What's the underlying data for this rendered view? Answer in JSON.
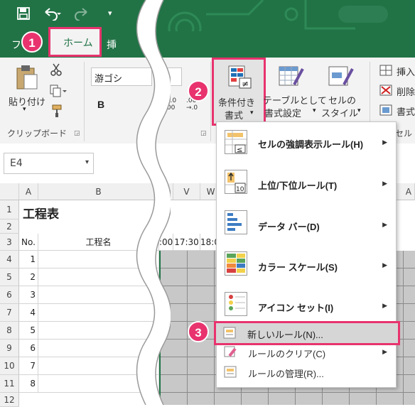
{
  "tabs": {
    "file_partial": "フ",
    "home": "ホーム",
    "insert_partial": "挿"
  },
  "badges": {
    "one": "1",
    "two": "2",
    "three": "3"
  },
  "clipboard": {
    "paste_label": "貼り付け",
    "group_label": "クリップボード"
  },
  "font": {
    "name_value": "游ゴシ",
    "bold": "B"
  },
  "number": {
    "dec_inc": ".0\n.00",
    "dec_dec": ".00\n→.0"
  },
  "styles": {
    "cond_format_line1": "条件付き",
    "cond_format_line2": "書式",
    "table_format_line1": "テーブルとして",
    "table_format_line2": "書式設定",
    "cell_style_line1": "セルの",
    "cell_style_line2": "スタイル"
  },
  "cells_group": {
    "insert": "挿入",
    "delete": "削除",
    "format": "書式",
    "group_partial": "セル"
  },
  "namebox": {
    "value": "E4"
  },
  "columns": {
    "a": "A",
    "b": "B",
    "v": "V",
    "w": "W",
    "far": "A"
  },
  "rows": [
    "1",
    "2",
    "3",
    "4",
    "5",
    "6",
    "7",
    "8",
    "9",
    "10",
    "11",
    "12"
  ],
  "sheet": {
    "title": "工程表",
    "header_no": "No.",
    "header_name": "工程名",
    "time_00": ":00",
    "time_1730": "17:30",
    "time_18": "18:0",
    "numbers": [
      "1",
      "2",
      "3",
      "4",
      "5",
      "6",
      "7",
      "8"
    ]
  },
  "menu": {
    "items": [
      {
        "label": "セルの強調表示ルール(H)",
        "icon": "highlight-rules-icon"
      },
      {
        "label": "上位/下位ルール(T)",
        "icon": "top-bottom-icon"
      },
      {
        "label": "データ バー(D)",
        "icon": "data-bar-icon"
      },
      {
        "label": "カラー スケール(S)",
        "icon": "color-scale-icon"
      },
      {
        "label": "アイコン セット(I)",
        "icon": "icon-set-icon"
      }
    ],
    "new_rule": "新しいルール(N)...",
    "clear_rules": "ルールのクリア(C)",
    "manage_rules": "ルールの管理(R)..."
  },
  "colors": {
    "excel_green": "#217346",
    "highlight": "#e8336e"
  }
}
